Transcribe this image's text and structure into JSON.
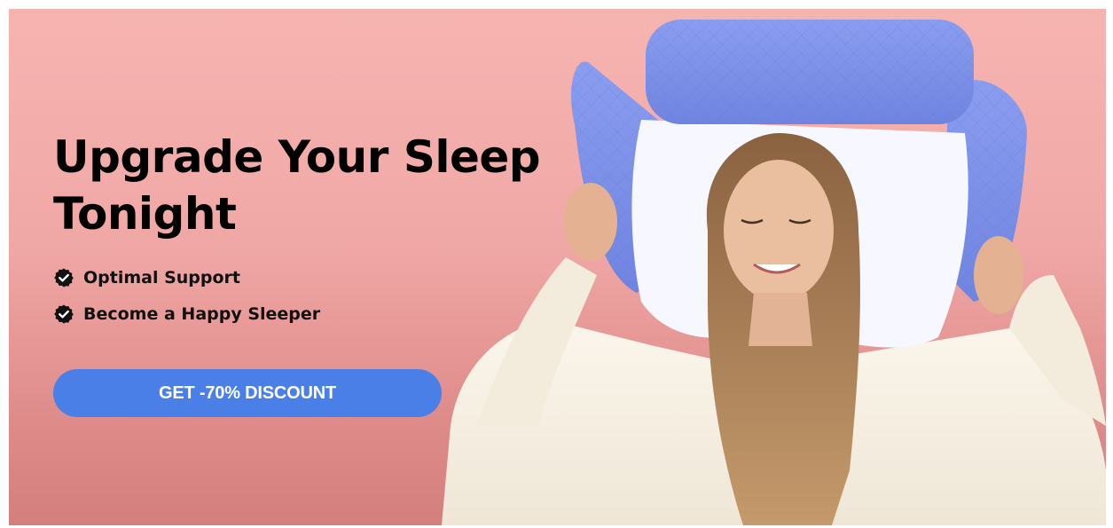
{
  "hero": {
    "headline": "Upgrade Your Sleep Tonight",
    "features": [
      {
        "label": "Optimal Support",
        "icon": "check-badge-icon"
      },
      {
        "label": "Become a Happy Sleeper",
        "icon": "check-badge-icon"
      }
    ],
    "cta_label": "GET -70% DISCOUNT"
  },
  "colors": {
    "background_top": "#f6b4b1",
    "background_bottom": "#d37f7e",
    "cta": "#4a7fe8",
    "cta_text": "#ffffff",
    "text": "#000000",
    "pillow": "#7f93e8"
  }
}
